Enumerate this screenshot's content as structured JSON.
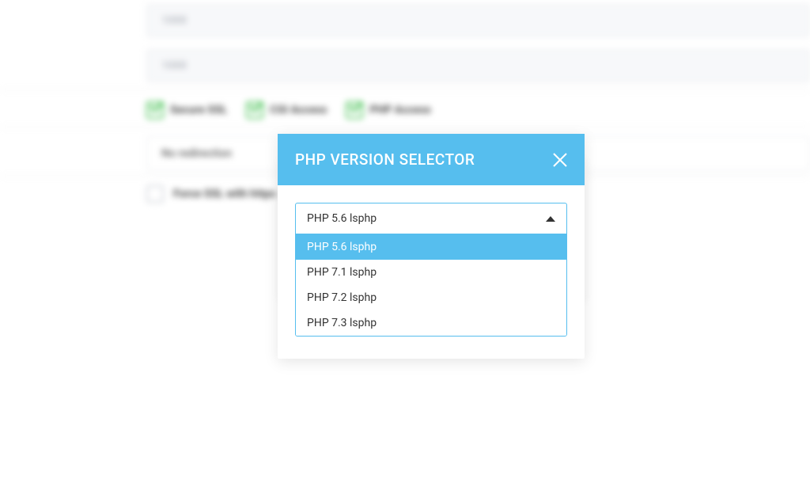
{
  "bg": {
    "input1": "1000",
    "input2": "1000",
    "checks": [
      {
        "label": "Secure SSL"
      },
      {
        "label": "CGI Access"
      },
      {
        "label": "PHP Access"
      }
    ],
    "redirect_select": "No redirection",
    "force_ssl_label": "Force SSL with https redirect"
  },
  "modal": {
    "title": "PHP VERSION SELECTOR",
    "selected": "PHP 5.6 lsphp",
    "options": [
      {
        "label": "PHP 5.6 lsphp",
        "selected": true
      },
      {
        "label": "PHP 7.1 lsphp",
        "selected": false
      },
      {
        "label": "PHP 7.2 lsphp",
        "selected": false
      },
      {
        "label": "PHP 7.3 lsphp",
        "selected": false
      }
    ]
  }
}
